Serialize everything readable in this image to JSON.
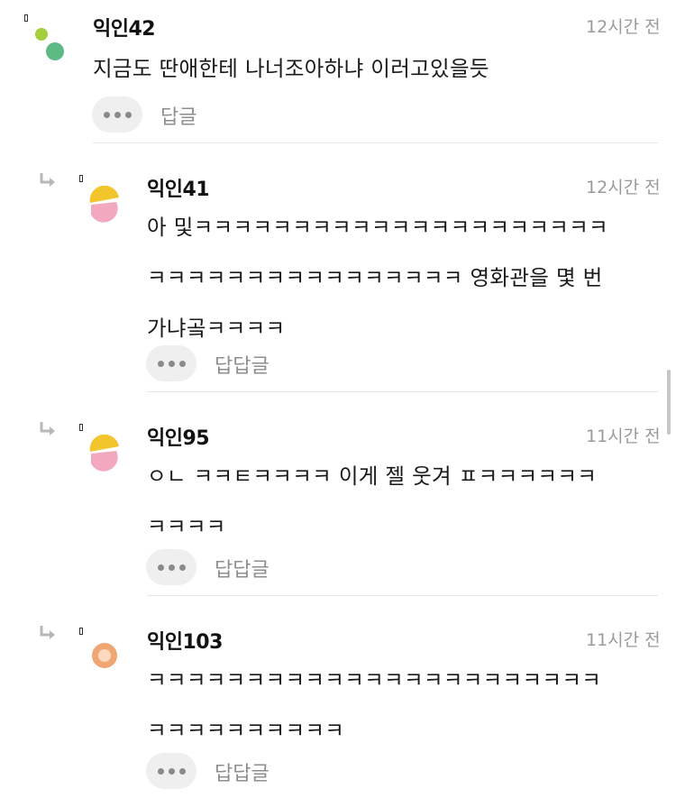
{
  "comments": [
    {
      "author": "익인42",
      "time": "12시간 전",
      "text": "지금도 딴애한테 나너조아하냐 이러고있을듯",
      "reply_label": "답글",
      "avatar_colors": [
        "#a3cf3e",
        "#5dba85"
      ]
    },
    {
      "author": "익인41",
      "time": "12시간 전",
      "text": "아 및ㅋㅋㅋㅋㅋㅋㅋㅋㅋㅋㅋㅋㅋㅋㅋㅋㅋㅋㅋㅋㅋ\nㅋㅋㅋㅋㅋㅋㅋㅋㅋㅋㅋㅋㅋㅋㅋㅋ 영화관을 몇 번\n가냐곸ㅋㅋㅋㅋ",
      "reply_label": "답답글",
      "avatar_colors": [
        "#f2c52c",
        "#f2a9c0"
      ]
    },
    {
      "author": "익인95",
      "time": "11시간 전",
      "text": "ㅇㄴ ㅋㅋㅌㅋㅋㅋㅋ 이게 젤 웃겨 ㅍㅋㅋㅋㅋㅋㅋ\nㅋㅋㅋㅋ",
      "reply_label": "답답글",
      "avatar_colors": [
        "#f2c52c",
        "#f2a9c0"
      ]
    },
    {
      "author": "익인103",
      "time": "11시간 전",
      "text": "ㅋㅋㅋㅋㅋㅋㅋㅋㅋㅋㅋㅋㅋㅋㅋㅋㅋㅋㅋㅋㅋㅋㅋ\nㅋㅋㅋㅋㅋㅋㅋㅋㅋㅋ",
      "reply_label": "답답글",
      "avatar_colors": [
        "#f0a673",
        "#fbd9be"
      ]
    }
  ],
  "icons": {
    "more": "more-dots-icon",
    "reply_arrow": "reply-arrow-icon"
  }
}
